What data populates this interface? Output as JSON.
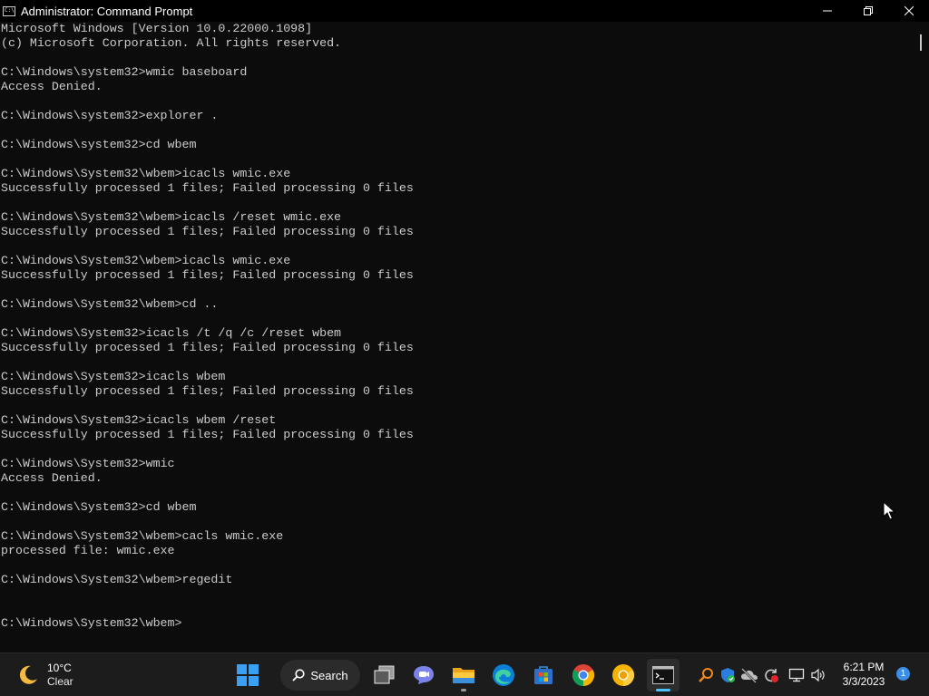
{
  "window": {
    "title": "Administrator: Command Prompt",
    "app_icon_text": "C:\\"
  },
  "console": {
    "lines": [
      "Microsoft Windows [Version 10.0.22000.1098]",
      "(c) Microsoft Corporation. All rights reserved.",
      "",
      "C:\\Windows\\system32>wmic baseboard",
      "Access Denied.",
      "",
      "C:\\Windows\\system32>explorer .",
      "",
      "C:\\Windows\\system32>cd wbem",
      "",
      "C:\\Windows\\System32\\wbem>icacls wmic.exe",
      "Successfully processed 1 files; Failed processing 0 files",
      "",
      "C:\\Windows\\System32\\wbem>icacls /reset wmic.exe",
      "Successfully processed 1 files; Failed processing 0 files",
      "",
      "C:\\Windows\\System32\\wbem>icacls wmic.exe",
      "Successfully processed 1 files; Failed processing 0 files",
      "",
      "C:\\Windows\\System32\\wbem>cd ..",
      "",
      "C:\\Windows\\System32>icacls /t /q /c /reset wbem",
      "Successfully processed 1 files; Failed processing 0 files",
      "",
      "C:\\Windows\\System32>icacls wbem",
      "Successfully processed 1 files; Failed processing 0 files",
      "",
      "C:\\Windows\\System32>icacls wbem /reset",
      "Successfully processed 1 files; Failed processing 0 files",
      "",
      "C:\\Windows\\System32>wmic",
      "Access Denied.",
      "",
      "C:\\Windows\\System32>cd wbem",
      "",
      "C:\\Windows\\System32\\wbem>cacls wmic.exe",
      "processed file: wmic.exe",
      "",
      "C:\\Windows\\System32\\wbem>regedit",
      "",
      "",
      "C:\\Windows\\System32\\wbem>"
    ]
  },
  "taskbar": {
    "weather": {
      "temp": "10°C",
      "condition": "Clear",
      "icon": "moon-icon"
    },
    "search_label": "Search",
    "pinned_apps": [
      "start",
      "search",
      "task-view",
      "teams-chat",
      "file-explorer",
      "edge",
      "microsoft-store",
      "chrome",
      "chrome-canary",
      "command-prompt"
    ],
    "tray_icons": [
      "search-tray",
      "windows-security",
      "network-off",
      "sync",
      "display",
      "volume"
    ],
    "clock": {
      "time": "6:21 PM",
      "date": "3/3/2023"
    },
    "notification_count": "1"
  },
  "colors": {
    "console_bg": "#0c0c0c",
    "console_text": "#cccccc",
    "taskbar_bg": "#1c1c1c",
    "accent": "#3a8ee6"
  }
}
